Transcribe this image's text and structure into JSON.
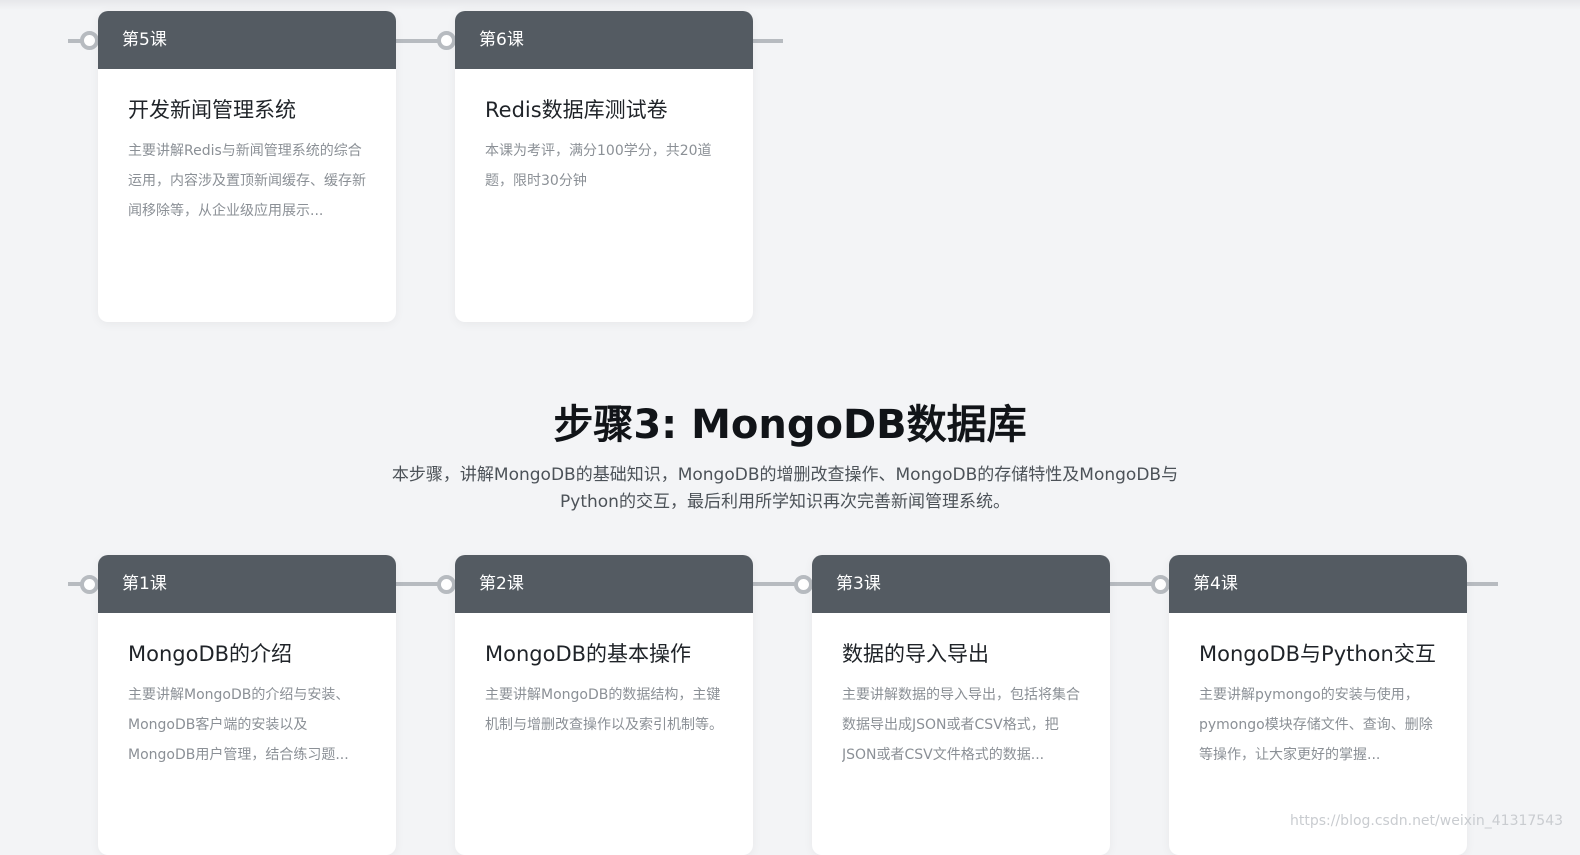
{
  "section_prev": {
    "lessons": [
      {
        "label": "第5课",
        "title": "开发新闻管理系统",
        "description": "主要讲解Redis与新闻管理系统的综合运用，内容涉及置顶新闻缓存、缓存新闻移除等，从企业级应用展示..."
      },
      {
        "label": "第6课",
        "title": "Redis数据库测试卷",
        "description": "本课为考评，满分100学分，共20道题，限时30分钟"
      }
    ]
  },
  "step3": {
    "title": "步骤3: MongoDB数据库",
    "description": "本步骤，讲解MongoDB的基础知识，MongoDB的增删改查操作、MongoDB的存储特性及MongoDB与Python的交互，最后利用所学知识再次完善新闻管理系统。",
    "lessons": [
      {
        "label": "第1课",
        "title": "MongoDB的介绍",
        "description": "主要讲解MongoDB的介绍与安装、MongoDB客户端的安装以及MongoDB用户管理，结合练习题..."
      },
      {
        "label": "第2课",
        "title": "MongoDB的基本操作",
        "description": "主要讲解MongoDB的数据结构，主键机制与增删改查操作以及索引机制等。"
      },
      {
        "label": "第3课",
        "title": "数据的导入导出",
        "description": "主要讲解数据的导入导出，包括将集合数据导出成JSON或者CSV格式，把JSON或者CSV文件格式的数据..."
      },
      {
        "label": "第4课",
        "title": "MongoDB与Python交互",
        "description": "主要讲解pymongo的安装与使用，pymongo模块存储文件、查询、删除等操作，让大家更好的掌握..."
      }
    ]
  },
  "watermark": "https://blog.csdn.net/weixin_41317543"
}
